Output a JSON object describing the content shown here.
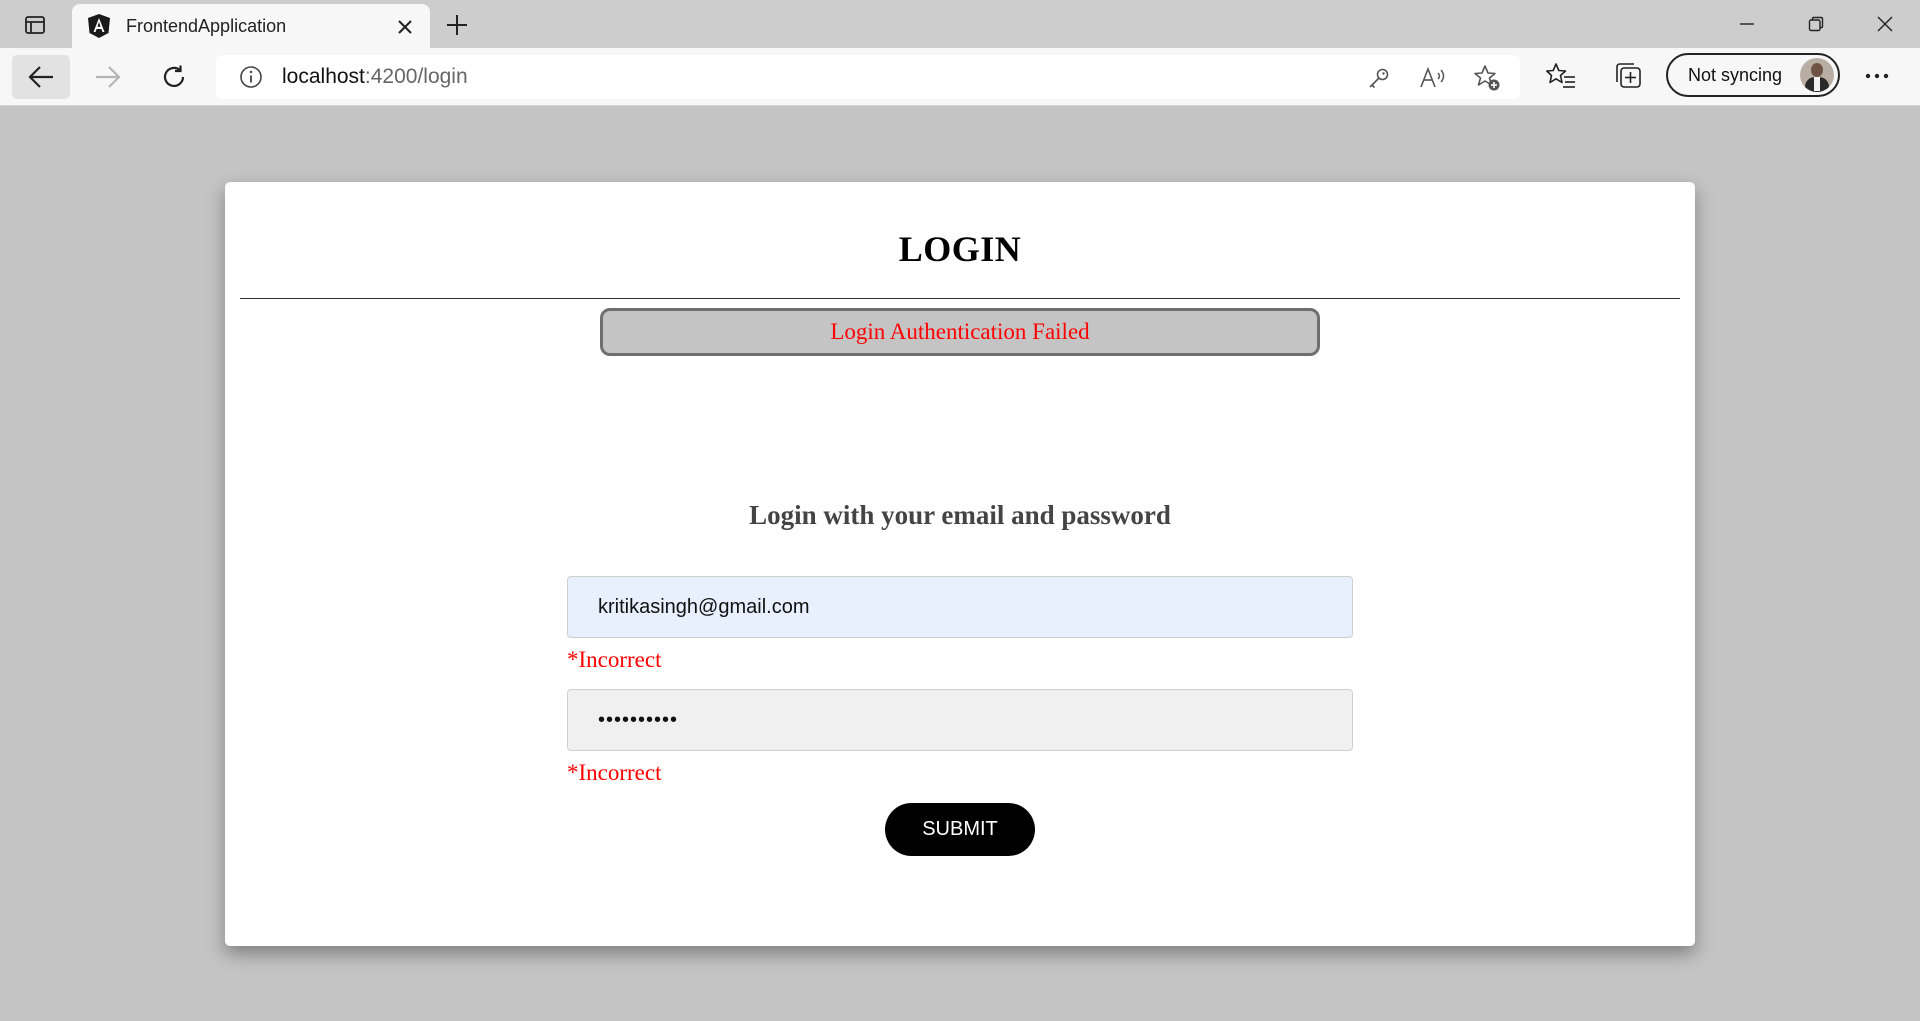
{
  "browser": {
    "tab": {
      "title": "FrontendApplication",
      "favicon": "angular-icon"
    },
    "address": {
      "host": "localhost",
      "rest": ":4200/login"
    },
    "profile": {
      "label": "Not syncing"
    }
  },
  "page": {
    "title": "LOGIN",
    "alert": "Login Authentication Failed",
    "subtitle": "Login with your email and password",
    "email": {
      "value": "kritikasingh@gmail.com"
    },
    "password": {
      "value": "••••••••••"
    },
    "email_error": "*Incorrect",
    "password_error": "*Incorrect",
    "submit_label": "SUBMIT"
  },
  "colors": {
    "error": "#ff0000",
    "alert_bg": "#c4c4c4",
    "email_bg": "#e8f0fe",
    "button_bg": "#000000"
  }
}
